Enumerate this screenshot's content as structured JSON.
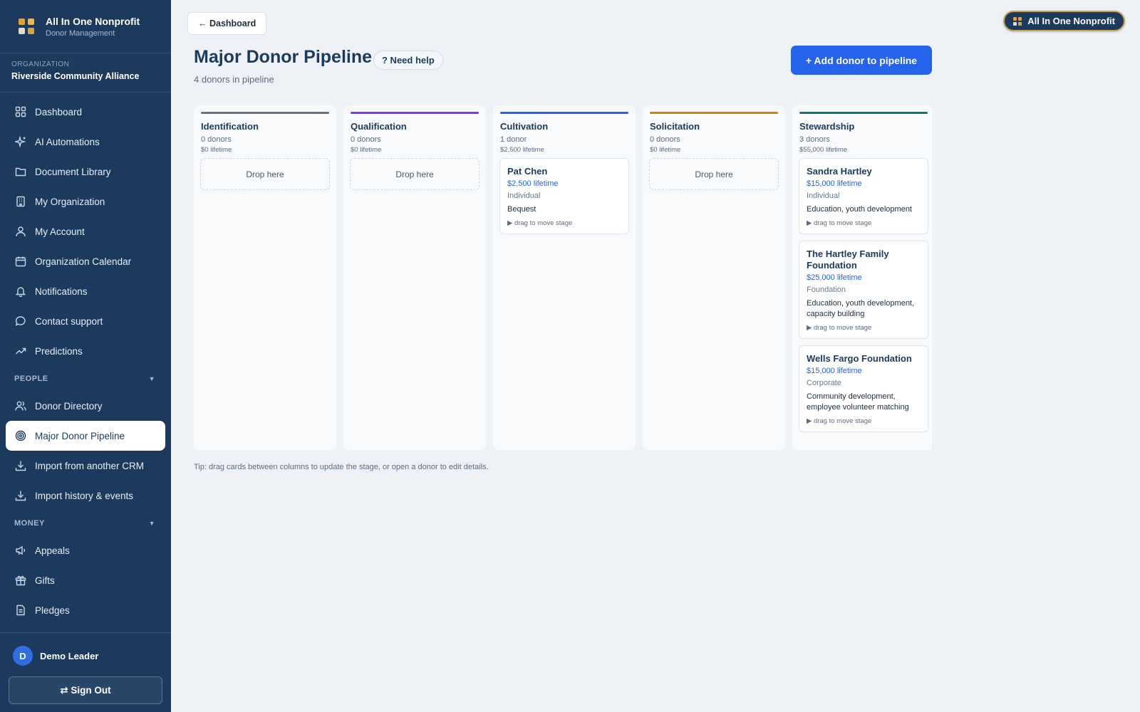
{
  "brand": {
    "title": "All In One Nonprofit",
    "subtitle": "Donor Management"
  },
  "org": {
    "label": "ORGANIZATION",
    "name": "Riverside Community Alliance"
  },
  "nav": {
    "items": [
      {
        "label": "Dashboard",
        "icon": "grid-icon"
      },
      {
        "label": "AI Automations",
        "icon": "sparkle-icon"
      },
      {
        "label": "Document Library",
        "icon": "folder-icon"
      },
      {
        "label": "My Organization",
        "icon": "building-icon"
      },
      {
        "label": "My Account",
        "icon": "user-icon"
      },
      {
        "label": "Organization Calendar",
        "icon": "calendar-icon"
      },
      {
        "label": "Notifications",
        "icon": "bell-icon"
      },
      {
        "label": "Contact support",
        "icon": "chat-icon"
      },
      {
        "label": "Predictions",
        "icon": "trend-icon"
      }
    ],
    "people_section": "PEOPLE",
    "people_items": [
      {
        "label": "Donor Directory",
        "icon": "users-icon"
      },
      {
        "label": "Major Donor Pipeline",
        "icon": "target-icon",
        "active": true
      },
      {
        "label": "Import from another CRM",
        "icon": "download-icon"
      },
      {
        "label": "Import history & events",
        "icon": "download-icon"
      }
    ],
    "money_section": "MONEY",
    "money_items": [
      {
        "label": "Appeals",
        "icon": "megaphone-icon"
      },
      {
        "label": "Gifts",
        "icon": "gift-icon"
      },
      {
        "label": "Pledges",
        "icon": "document-icon"
      }
    ]
  },
  "user": {
    "initial": "D",
    "name": "Demo Leader",
    "signout_label": "⇄ Sign Out"
  },
  "header": {
    "back_label": "← Dashboard",
    "badge_label": "All In One Nonprofit",
    "title": "Major Donor Pipeline",
    "help_label": "? Need help",
    "subtitle": "4 donors in pipeline",
    "add_label": "+ Add donor to pipeline"
  },
  "columns": [
    {
      "title": "Identification",
      "count": "0 donors",
      "lifetime": "$0 lifetime",
      "color": "#6b7280",
      "drop": "Drop here",
      "cards": []
    },
    {
      "title": "Qualification",
      "count": "0 donors",
      "lifetime": "$0 lifetime",
      "color": "#7c3aed",
      "drop": "Drop here",
      "cards": []
    },
    {
      "title": "Cultivation",
      "count": "1 donor",
      "lifetime": "$2,500 lifetime",
      "color": "#2563eb",
      "cards": [
        {
          "name": "Pat Chen",
          "amount": "$2,500 lifetime",
          "type": "Individual",
          "desc": "Bequest",
          "hint": "▶ drag to move stage"
        }
      ]
    },
    {
      "title": "Solicitation",
      "count": "0 donors",
      "lifetime": "$0 lifetime",
      "color": "#ca8a04",
      "drop": "Drop here",
      "cards": []
    },
    {
      "title": "Stewardship",
      "count": "3 donors",
      "lifetime": "$55,000 lifetime",
      "color": "#0f766e",
      "cards": [
        {
          "name": "Sandra Hartley",
          "amount": "$15,000 lifetime",
          "type": "Individual",
          "desc": "Education, youth development",
          "hint": "▶ drag to move stage"
        },
        {
          "name": "The Hartley Family Foundation",
          "amount": "$25,000 lifetime",
          "type": "Foundation",
          "desc": "Education, youth development, capacity building",
          "hint": "▶ drag to move stage"
        },
        {
          "name": "Wells Fargo Foundation",
          "amount": "$15,000 lifetime",
          "type": "Corporate",
          "desc": "Community development, employee volunteer matching",
          "hint": "▶ drag to move stage"
        }
      ]
    }
  ],
  "tip": "Tip: drag cards between columns to update the stage, or open a donor to edit details."
}
